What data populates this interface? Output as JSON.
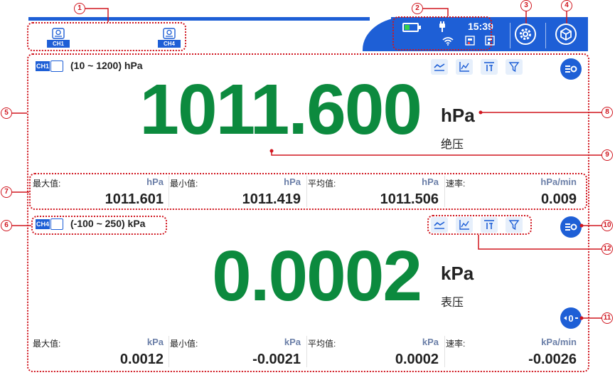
{
  "statusbar": {
    "time": "15:39",
    "battery_level": 0.4,
    "channels": [
      {
        "label": "CH1",
        "icon": "pressure-sensor-icon"
      },
      {
        "label": "CH4",
        "icon": "pressure-sensor-icon"
      }
    ],
    "icons": [
      "battery-icon",
      "plug-icon",
      "wifi-icon",
      "device-icon",
      "device-icon",
      "settings-gear-icon",
      "cube-icon"
    ]
  },
  "channel1": {
    "tag": "CH1",
    "range": "(10 ~ 1200) hPa",
    "value": "1011.600",
    "unit": "hPa",
    "pressure_type": "绝压",
    "stats": [
      {
        "label": "最大值:",
        "unit": "hPa",
        "value": "1011.601"
      },
      {
        "label": "最小值:",
        "unit": "hPa",
        "value": "1011.419"
      },
      {
        "label": "平均值:",
        "unit": "hPa",
        "value": "1011.506"
      },
      {
        "label": "速率:",
        "unit": "hPa/min",
        "value": "0.009"
      }
    ]
  },
  "channel4": {
    "tag": "CH4",
    "range": "(-100 ~ 250) kPa",
    "value": "0.0002",
    "unit": "kPa",
    "pressure_type": "表压",
    "zero_label": "0",
    "stats": [
      {
        "label": "最大值:",
        "unit": "kPa",
        "value": "0.0012"
      },
      {
        "label": "最小值:",
        "unit": "kPa",
        "value": "-0.0021"
      },
      {
        "label": "平均值:",
        "unit": "kPa",
        "value": "0.0002"
      },
      {
        "label": "速率:",
        "unit": "kPa/min",
        "value": "-0.0026"
      }
    ]
  },
  "callouts": [
    "1",
    "2",
    "3",
    "4",
    "5",
    "6",
    "7",
    "8",
    "9",
    "10",
    "11",
    "12"
  ],
  "colors": {
    "accent": "#1e5fd6",
    "value_green": "#0c8a3e",
    "callout_red": "#d0161f"
  }
}
